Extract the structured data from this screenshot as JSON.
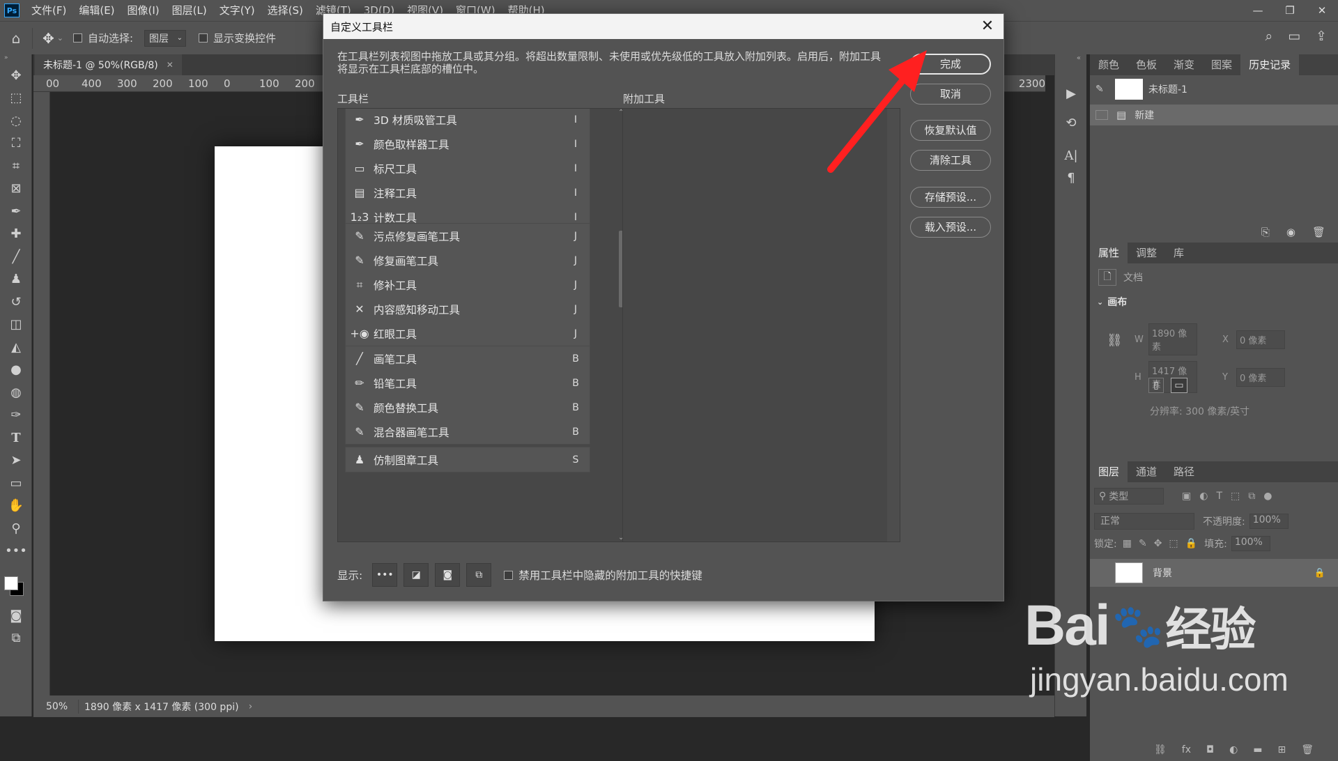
{
  "menubar": {
    "logo": "Ps",
    "items": [
      "文件(F)",
      "编辑(E)",
      "图像(I)",
      "图层(L)",
      "文字(Y)",
      "选择(S)",
      "滤镜(T)",
      "3D(D)",
      "视图(V)",
      "窗口(W)",
      "帮助(H)"
    ]
  },
  "options": {
    "auto_select_label": "自动选择:",
    "auto_select_value": "图层",
    "show_transform_label": "显示变换控件"
  },
  "document": {
    "tab_title": "未标题-1 @ 50%(RGB/8)",
    "ruler_ticks": [
      "00",
      "400",
      "300",
      "200",
      "100",
      "0",
      "100",
      "200"
    ],
    "ruler_right_tick": "2300",
    "zoom": "50%",
    "doc_info": "1890 像素 x 1417 像素 (300 ppi)"
  },
  "dialog": {
    "title": "自定义工具栏",
    "description": "在工具栏列表视图中拖放工具或其分组。将超出数量限制、未使用或优先级低的工具放入附加列表。启用后，附加工具将显示在工具栏底部的槽位中。",
    "toolbar_label": "工具栏",
    "extra_label": "附加工具",
    "groups": [
      {
        "tools": [
          {
            "icon": "3d-material-eyedropper-icon",
            "glyph": "✒",
            "name": "3D 材质吸管工具",
            "key": "I"
          },
          {
            "icon": "color-sampler-icon",
            "glyph": "✒",
            "name": "颜色取样器工具",
            "key": "I"
          },
          {
            "icon": "ruler-icon",
            "glyph": "▭",
            "name": "标尺工具",
            "key": "I"
          },
          {
            "icon": "note-icon",
            "glyph": "▤",
            "name": "注释工具",
            "key": "I"
          },
          {
            "icon": "count-icon",
            "glyph": "1₂3",
            "name": "计数工具",
            "key": "I"
          }
        ]
      },
      {
        "tools": [
          {
            "icon": "spot-healing-brush-icon",
            "glyph": "✎",
            "name": "污点修复画笔工具",
            "key": "J"
          },
          {
            "icon": "healing-brush-icon",
            "glyph": "✎",
            "name": "修复画笔工具",
            "key": "J"
          },
          {
            "icon": "patch-icon",
            "glyph": "⌗",
            "name": "修补工具",
            "key": "J"
          },
          {
            "icon": "content-aware-move-icon",
            "glyph": "✕",
            "name": "内容感知移动工具",
            "key": "J"
          },
          {
            "icon": "red-eye-icon",
            "glyph": "+◉",
            "name": "红眼工具",
            "key": "J"
          }
        ]
      },
      {
        "tools": [
          {
            "icon": "brush-icon",
            "glyph": "╱",
            "name": "画笔工具",
            "key": "B"
          },
          {
            "icon": "pencil-icon",
            "glyph": "✏",
            "name": "铅笔工具",
            "key": "B"
          },
          {
            "icon": "color-replacement-icon",
            "glyph": "✎",
            "name": "颜色替换工具",
            "key": "B"
          },
          {
            "icon": "mixer-brush-icon",
            "glyph": "✎",
            "name": "混合器画笔工具",
            "key": "B"
          }
        ]
      },
      {
        "tools": [
          {
            "icon": "clone-stamp-icon",
            "glyph": "♟",
            "name": "仿制图章工具",
            "key": "S"
          }
        ]
      }
    ],
    "buttons": {
      "done": "完成",
      "cancel": "取消",
      "restore_defaults": "恢复默认值",
      "clear_tools": "清除工具",
      "save_preset": "存储预设...",
      "load_preset": "载入预设..."
    },
    "show_label": "显示:",
    "disable_shortcuts_label": "禁用工具栏中隐藏的附加工具的快捷键"
  },
  "history_panel": {
    "tabs": [
      "颜色",
      "色板",
      "渐变",
      "图案",
      "历史记录"
    ],
    "active_tab": "历史记录",
    "snapshot_name": "未标题-1",
    "states": [
      "新建"
    ]
  },
  "properties_panel": {
    "tabs": [
      "属性",
      "调整",
      "库"
    ],
    "doc_label": "文档",
    "canvas_label": "画布",
    "w_label": "W",
    "w_value": "1890 像素",
    "h_label": "H",
    "h_value": "1417 像素",
    "x_label": "X",
    "x_value": "0 像素",
    "y_label": "Y",
    "y_value": "0 像素",
    "resolution": "分辨率: 300 像素/英寸"
  },
  "layers_panel": {
    "tabs": [
      "图层",
      "通道",
      "路径"
    ],
    "filter_placeholder": "类型",
    "blend_mode": "正常",
    "opacity_label": "不透明度:",
    "opacity_value": "100%",
    "lock_label": "锁定:",
    "fill_label": "填充:",
    "fill_value": "100%",
    "layer_name": "背景"
  },
  "watermark": {
    "brand": "Bai",
    "brand2": "经验",
    "url": "jingyan.baidu.com"
  },
  "colors": {
    "accent_arrow": "#ff2020",
    "ps_blue": "#31a8ff"
  }
}
